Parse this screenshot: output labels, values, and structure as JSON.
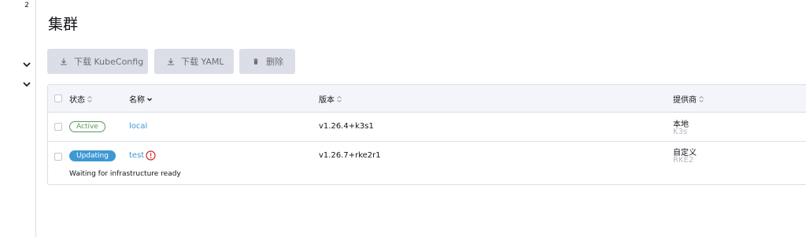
{
  "sidebar": {
    "badge": "2"
  },
  "page": {
    "title": "集群"
  },
  "toolbar": {
    "download_kubeconfig": "下载 KubeConfig",
    "download_yaml": "下载 YAML",
    "delete": "删除"
  },
  "table": {
    "columns": {
      "state": "状态",
      "name": "名称",
      "version": "版本",
      "provider": "提供商"
    },
    "rows": [
      {
        "state": "Active",
        "name": "local",
        "version": "v1.26.4+k3s1",
        "provider": "本地",
        "provider_sub": "K3s",
        "message": ""
      },
      {
        "state": "Updating",
        "name": "test",
        "version": "v1.26.7+rke2r1",
        "provider": "自定义",
        "provider_sub": "RKE2",
        "message": "Waiting for infrastructure ready"
      }
    ]
  },
  "colors": {
    "accent": "#3d98d3",
    "active": "#5d995d",
    "error": "#d22b2b",
    "button_bg": "#dcdee7"
  }
}
